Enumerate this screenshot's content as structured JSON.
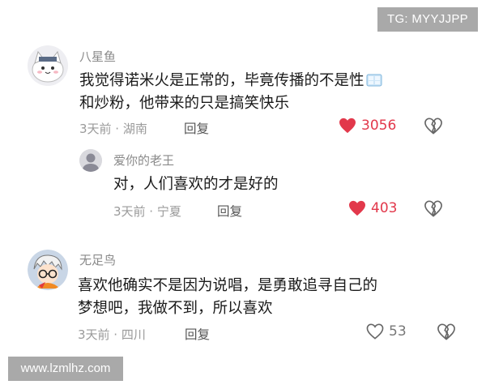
{
  "watermarks": {
    "top": "TG: MYYJJPP",
    "bottom": "www.lzmlhz.com"
  },
  "comments": [
    {
      "username": "八星鱼",
      "text_line1": "我觉得诺米火是正常的，毕竟传播的不是性",
      "text_line2": "和炒粉，他带来的只是搞笑快乐",
      "meta": "3天前 · 湖南",
      "reply_label": "回复",
      "likes": "3056",
      "liked": true,
      "icon": "ice-cube-emoji"
    },
    {
      "username": "爱你的老王",
      "text_line1": "对，人们喜欢的才是好的",
      "meta": "3天前 · 宁夏",
      "reply_label": "回复",
      "likes": "403",
      "liked": true
    },
    {
      "username": "无足鸟",
      "text_line1": "喜欢他确实不是因为说唱，是勇敢追寻自己的",
      "text_line2": "梦想吧，我做不到，所以喜欢",
      "meta": "3天前 · 四川",
      "reply_label": "回复",
      "likes": "53",
      "liked": false
    }
  ],
  "colors": {
    "like_red": "#e2384b",
    "meta_gray": "#9a9a9a"
  }
}
